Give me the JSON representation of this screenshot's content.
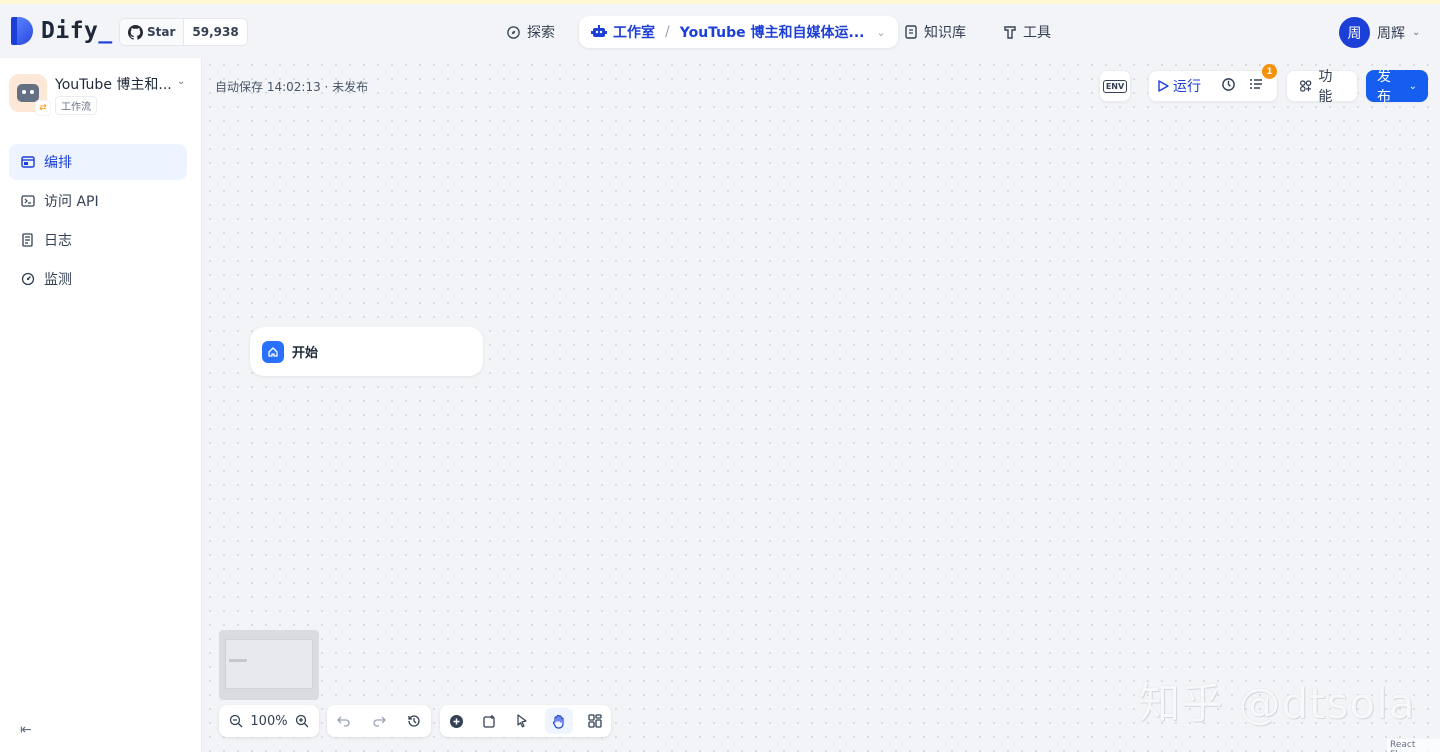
{
  "header": {
    "brand": "Dify",
    "brand_suffix": "_",
    "github": {
      "star_label": "Star",
      "star_count": "59,938"
    },
    "nav": {
      "explore": "探索",
      "studio": "工作室",
      "studio_app": "YouTube 博主和自媒体运...",
      "knowledge": "知识库",
      "tools": "工具"
    },
    "user": {
      "avatar_initial": "周",
      "name": "周辉"
    }
  },
  "sidebar": {
    "app_name": "YouTube 博主和...",
    "app_type": "工作流",
    "items": [
      {
        "label": "编排",
        "icon": "layout-icon",
        "active": true
      },
      {
        "label": "访问 API",
        "icon": "terminal-icon",
        "active": false
      },
      {
        "label": "日志",
        "icon": "log-icon",
        "active": false
      },
      {
        "label": "监测",
        "icon": "monitor-icon",
        "active": false
      }
    ]
  },
  "canvas": {
    "autosave": "自动保存 14:02:13 · 未发布",
    "toolbar": {
      "env": "ENV",
      "run": "运行",
      "checklist_badge": "1",
      "features": "功能",
      "publish": "发布"
    },
    "start_node": "开始",
    "zoom": "100%",
    "watermark": "知乎 @dtsola",
    "attribution": "React Flow"
  },
  "colors": {
    "accent": "#155eef",
    "brand": "#1c3fd8",
    "badge": "#f79009"
  }
}
